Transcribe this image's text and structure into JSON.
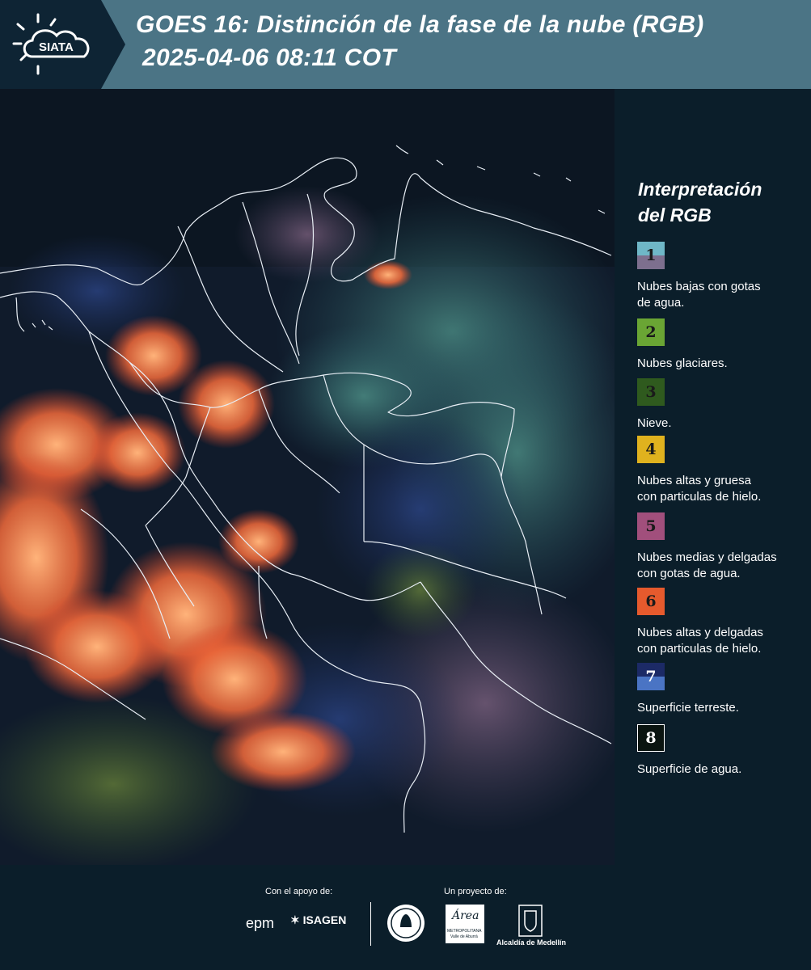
{
  "header": {
    "title_line1": "GOES 16: Distinción de la fase de la nube (RGB)",
    "title_line2": "2025-04-06 08:11 COT",
    "logo_text": "SIATA",
    "background": "#4b7485"
  },
  "legend": {
    "title_line1": "Interpretación",
    "title_line2": "del RGB",
    "items": [
      {
        "number": "1",
        "label_line1": "Nubes bajas con gotas",
        "label_line2": "de agua.",
        "color_top": "#6fb7c7",
        "color_bottom": "#7d6f8e"
      },
      {
        "number": "2",
        "label_line1": "Nubes glaciares.",
        "label_line2": "",
        "color_top": "#6aa534",
        "color_bottom": "#6aa534"
      },
      {
        "number": "3",
        "label_line1": "Nieve.",
        "label_line2": "",
        "color_top": "#2f5a1e",
        "color_bottom": "#2f5a1e"
      },
      {
        "number": "4",
        "label_line1": "Nubes altas y gruesa",
        "label_line2": "con particulas de hielo.",
        "color_top": "#e0b21e",
        "color_bottom": "#e0b21e"
      },
      {
        "number": "5",
        "label_line1": "Nubes medias y delgadas",
        "label_line2": "con gotas de agua.",
        "color_top": "#a14f7c",
        "color_bottom": "#a14f7c"
      },
      {
        "number": "6",
        "label_line1": "Nubes altas y delgadas",
        "label_line2": "con particulas de hielo.",
        "color_top": "#e65a2d",
        "color_bottom": "#e65a2d"
      },
      {
        "number": "7",
        "label_line1": "Superficie terreste.",
        "label_line2": "",
        "color_top": "#1c2a66",
        "color_bottom": "#4a74c4"
      },
      {
        "number": "8",
        "label_line1": "Superficie de agua.",
        "label_line2": "",
        "color_top": "#0a1410",
        "color_bottom": "#0a1410"
      }
    ]
  },
  "footer": {
    "support_label": "Con el apoyo de:",
    "project_label": "Un proyecto de:",
    "epm": "epm",
    "isagen": "ISAGEN",
    "area_line1": "Área",
    "area_line2": "METROPOLITANA",
    "area_line3": "Valle de Aburrá",
    "alcaldia": "Alcaldía de Medellín"
  }
}
